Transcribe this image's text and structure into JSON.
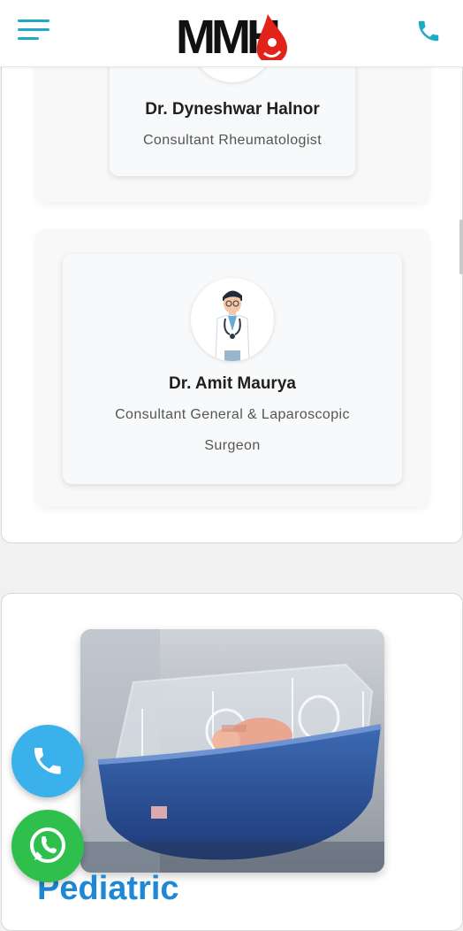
{
  "header": {
    "logo_text": "MMH",
    "menu_icon": "hamburger-menu-icon",
    "phone_icon": "phone-icon"
  },
  "doctors": [
    {
      "name": "Dr. Dyneshwar Halnor",
      "role": "Consultant Rheumatologist"
    },
    {
      "name": "Dr. Amit Maurya",
      "role_line1": "Consultant General & Laparoscopic",
      "role_line2": "Surgeon"
    }
  ],
  "pediatric": {
    "title": "Pediatric"
  },
  "floating": {
    "call_icon": "phone-icon",
    "whatsapp_icon": "whatsapp-icon"
  },
  "colors": {
    "accent": "#1fa9c4",
    "title_blue": "#1e88d4",
    "logo_red": "#e2231a",
    "call_button": "#3ab1ea",
    "whatsapp_button": "#2fbf4d"
  }
}
